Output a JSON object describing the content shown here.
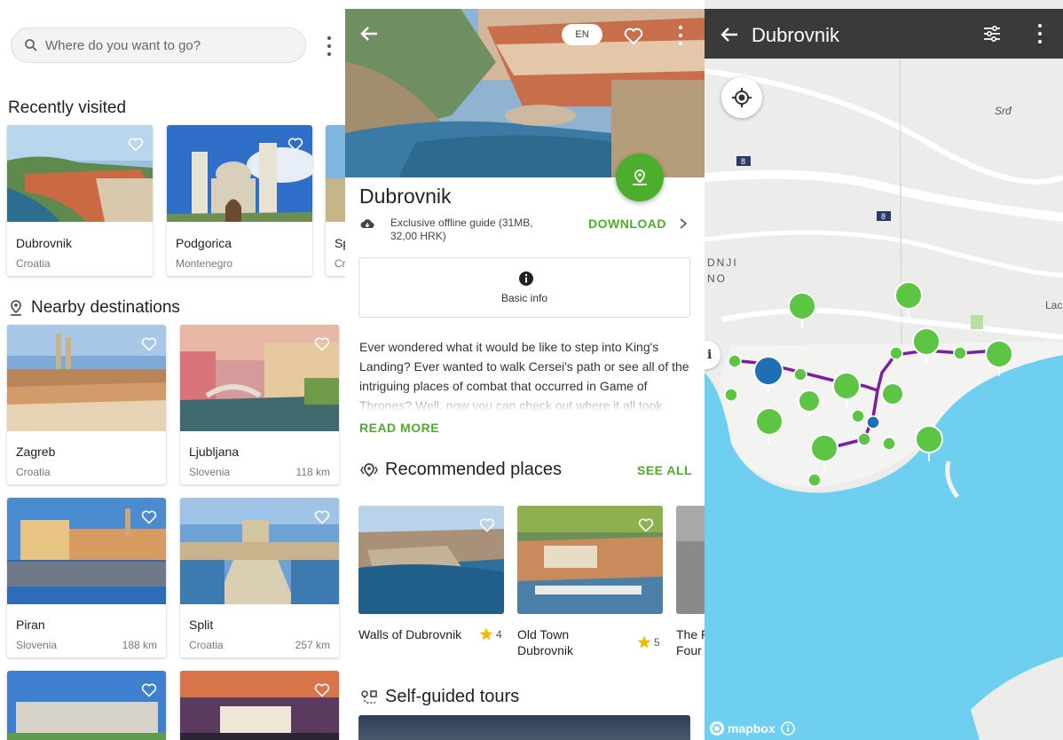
{
  "home": {
    "search_placeholder": "Where do you want to go?",
    "recently_visited_title": "Recently visited",
    "nearby_title": "Nearby destinations",
    "recent": [
      {
        "name": "Dubrovnik",
        "country": "Croatia"
      },
      {
        "name": "Podgorica",
        "country": "Montenegro"
      },
      {
        "name": "Sp",
        "country": "Cr"
      }
    ],
    "nearby": [
      {
        "name": "Zagreb",
        "country": "Croatia",
        "distance": ""
      },
      {
        "name": "Ljubljana",
        "country": "Slovenia",
        "distance": "118 km"
      },
      {
        "name": "Piran",
        "country": "Slovenia",
        "distance": "188 km"
      },
      {
        "name": "Split",
        "country": "Croatia",
        "distance": "257 km"
      }
    ]
  },
  "detail": {
    "lang": "EN",
    "title": "Dubrovnik",
    "offline_text": "Exclusive offline guide (31MB, 32,00 HRK)",
    "download_label": "DOWNLOAD",
    "basic_info_label": "Basic info",
    "description": "Ever wondered what it would be like to step into King's Landing? Ever wanted to walk Cersei's path or see all of the intriguing places of combat that occurred in Game of Thrones? Well, now you can check out where it all took",
    "read_more": "READ MORE",
    "recommended_title": "Recommended places",
    "see_all": "SEE ALL",
    "places": [
      {
        "name": "Walls of Dubrovnik",
        "rating": "4"
      },
      {
        "name": "Old Town Dubrovnik",
        "rating": "5"
      },
      {
        "name": "The F Four",
        "rating": ""
      }
    ],
    "tours_title": "Self-guided tours"
  },
  "map": {
    "title": "Dubrovnik",
    "labels": {
      "srd": "Srđ",
      "lac": "Lac",
      "dnji": "DNJI",
      "no": "NO",
      "road1": "8",
      "road2": "8"
    },
    "attribution": "mapbox",
    "accent_green": "#4caf2b",
    "route_purple": "#7b1fa2",
    "water": "#6ecff0"
  }
}
